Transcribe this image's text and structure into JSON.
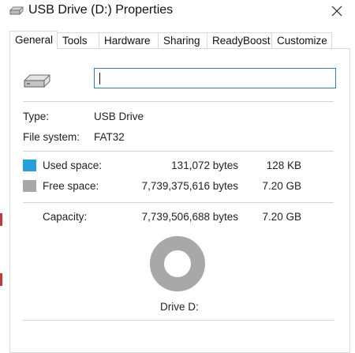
{
  "window": {
    "title": "USB Drive (D:) Properties",
    "close_glyph": "✕",
    "title_icon": "usb-drive-icon"
  },
  "tabs": [
    {
      "label": "General",
      "active": true
    },
    {
      "label": "Tools",
      "active": false
    },
    {
      "label": "Hardware",
      "active": false
    },
    {
      "label": "Sharing",
      "active": false
    },
    {
      "label": "ReadyBoost",
      "active": false
    },
    {
      "label": "Customize",
      "active": false
    }
  ],
  "general": {
    "drive_icon": "usb-drive-icon",
    "name_value": "",
    "type_label": "Type:",
    "type_value": "USB Drive",
    "fs_label": "File system:",
    "fs_value": "FAT32",
    "used": {
      "label": "Used space:",
      "bytes": "131,072 bytes",
      "size": "128 KB",
      "color": "#26a0da"
    },
    "free": {
      "label": "Free space:",
      "bytes": "7,739,375,616 bytes",
      "size": "7.20 GB",
      "color": "#a8a8a8"
    },
    "capacity": {
      "label": "Capacity:",
      "bytes": "7,739,506,688 bytes",
      "size": "7.20 GB"
    },
    "drive_label": "Drive D:"
  }
}
